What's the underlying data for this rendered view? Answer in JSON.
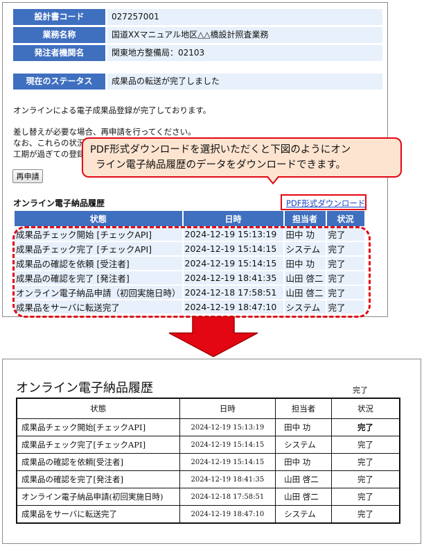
{
  "info": [
    {
      "label": "設計書コード",
      "value": "027257001"
    },
    {
      "label": "業務名称",
      "value": "国道XXマニュアル地区△△橋設計照査業務"
    },
    {
      "label": "発注者機関名",
      "value": "関東地方整備局：02103"
    }
  ],
  "status": {
    "label": "現在のステータス",
    "value": "成果品の転送が完了しました"
  },
  "messages": {
    "line1": "オンラインによる電子成果品登録が完了しております。",
    "line2": "差し替えが必要な場合、再申請を行ってください。",
    "line3": "なお、これらの状況は",
    "line4": "工期が過ぎての登録"
  },
  "reapply_button": "再申請",
  "history": {
    "title": "オンライン電子納品履歴",
    "pdf_link": "PDF形式ダウンロード",
    "headers": [
      "状態",
      "日時",
      "担当者",
      "状況"
    ],
    "rows": [
      [
        "成果品チェック開始 [チェックAPI]",
        "2024-12-19 15:13:19",
        "田中 功",
        "完了"
      ],
      [
        "成果品チェック完了 [チェックAPI]",
        "2024-12-19 15:14:15",
        "システム",
        "完了"
      ],
      [
        "成果品の確認を依頼 [受注者]",
        "2024-12-19 15:14:15",
        "田中 功",
        "完了"
      ],
      [
        "成果品の確認を完了 [発注者]",
        "2024-12-19 18:41:35",
        "山田 啓二",
        "完了"
      ],
      [
        "オンライン電子納品申請（初回実施日時）",
        "2024-12-18 17:58:51",
        "山田 啓二",
        "完了"
      ],
      [
        "成果品をサーバに転送完了",
        "2024-12-19 18:47:10",
        "システム",
        "完了"
      ]
    ]
  },
  "callout": {
    "line1": "PDF形式ダウンロードを選択いただくと下図のようにオン",
    "line2": "ライン電子納品履歴のデータをダウンロードできます。"
  },
  "doc": {
    "title": "オンライン電子納品履歴",
    "status": "完了",
    "headers": [
      "状態",
      "日時",
      "担当者",
      "状況"
    ],
    "rows": [
      [
        "成果品チェック開始[チェックAPI]",
        "2024-12-19 15:13:19",
        "田中 功",
        "完了"
      ],
      [
        "成果品チェック完了[チェックAPI]",
        "2024-12-19 15:14:15",
        "システム",
        "完了"
      ],
      [
        "成果品の確認を依頼[受注者]",
        "2024-12-19 15:14:15",
        "田中 功",
        "完了"
      ],
      [
        "成果品の確認を完了[発注者]",
        "2024-12-19 18:41:35",
        "山田 啓二",
        "完了"
      ],
      [
        "オンライン電子納品申請(初回実施日時)",
        "2024-12-18 17:58:51",
        "山田 啓二",
        "完了"
      ],
      [
        "成果品をサーバに転送完了",
        "2024-12-19 18:47:10",
        "システム",
        "完了"
      ]
    ]
  },
  "colors": {
    "header_blue": "#3f6fbf",
    "cell_blue": "#e7f0fb",
    "highlight_red": "#e30613",
    "callout_fill": "#fde4d0"
  }
}
